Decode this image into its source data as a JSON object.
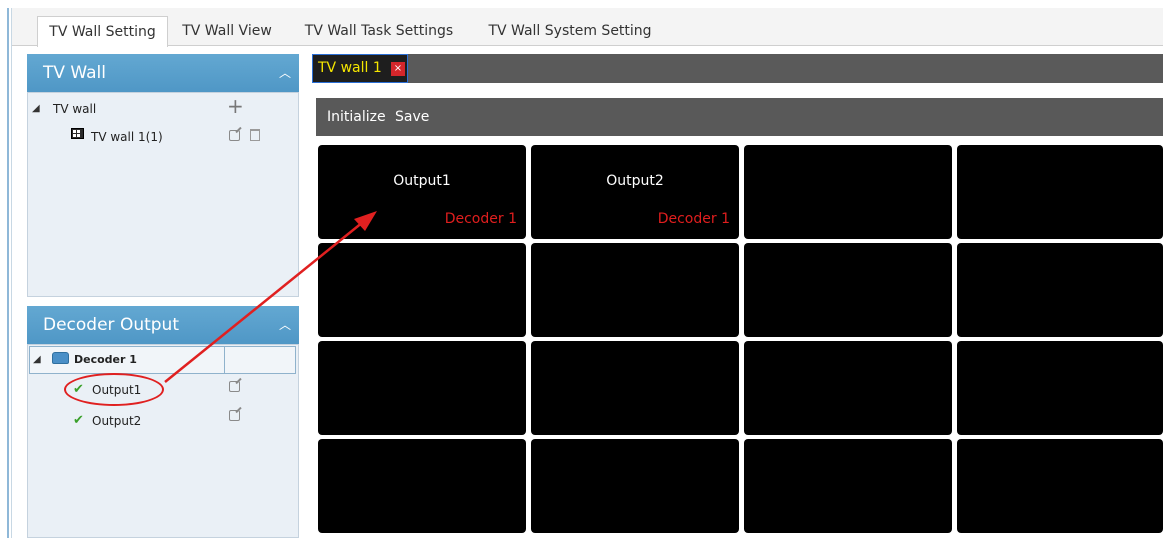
{
  "tabs": [
    {
      "label": "TV Wall Setting",
      "active": true
    },
    {
      "label": "TV Wall View",
      "active": false
    },
    {
      "label": "TV Wall Task Settings",
      "active": false
    },
    {
      "label": "TV Wall System Setting",
      "active": false
    }
  ],
  "tv_wall_panel": {
    "title": "TV Wall",
    "root_label": "TV wall",
    "item_label": "TV wall 1(1)"
  },
  "decoder_panel": {
    "title": "Decoder Output",
    "decoder_label": "Decoder 1",
    "outputs": [
      "Output1",
      "Output2"
    ]
  },
  "view": {
    "tab_label": "TV wall 1",
    "close_glyph": "×",
    "toolbar": {
      "initialize": "Initialize",
      "save": "Save"
    },
    "cells": [
      {
        "output": "Output1",
        "decoder": "Decoder 1"
      },
      {
        "output": "Output2",
        "decoder": "Decoder 1"
      }
    ]
  },
  "colors": {
    "panel_header": "#5aa0cd",
    "decoder_text": "#e01e1e",
    "annotation": "#e02020",
    "tab_text": "#f5e600"
  },
  "icons": {
    "collapse": "chevron-up-icon",
    "add": "plus-icon",
    "edit": "edit-icon",
    "delete": "trash-icon",
    "check": "check-icon"
  }
}
